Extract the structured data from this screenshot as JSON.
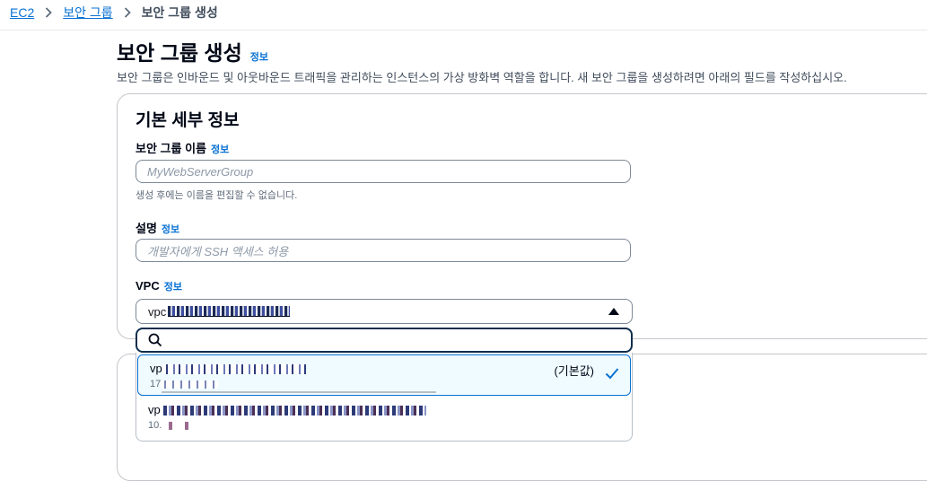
{
  "breadcrumb": {
    "root": "EC2",
    "parent": "보안 그룹",
    "current": "보안 그룹 생성"
  },
  "page": {
    "title": "보안 그룹 생성",
    "info_link": "정보",
    "description": "보안 그룹은 인바운드 및 아웃바운드 트래픽을 관리하는 인스턴스의 가상 방화벽 역할을 합니다. 새 보안 그룹을 생성하려면 아래의 필드를 작성하십시오."
  },
  "basic_details": {
    "title": "기본 세부 정보",
    "name_label": "보안 그룹 이름",
    "name_info": "정보",
    "name_placeholder": "MyWebServerGroup",
    "name_help": "생성 후에는 이름을 편집할 수 없습니다.",
    "desc_label": "설명",
    "desc_info": "정보",
    "desc_placeholder": "개발자에게 SSH 액세스 허용",
    "vpc_label": "VPC",
    "vpc_info": "정보",
    "vpc_selected_prefix": "vpc"
  },
  "vpc_dropdown": {
    "search_value": "",
    "options": [
      {
        "id_prefix": "vp",
        "cidr_prefix": "17",
        "tag": "(기본값)",
        "selected": true
      },
      {
        "id_prefix": "vp",
        "cidr_prefix": "10.",
        "tag": "",
        "selected": false
      }
    ]
  },
  "colors": {
    "link": "#0972d3",
    "accent_border": "#0972d3",
    "focus_border": "#0f2d4d"
  }
}
